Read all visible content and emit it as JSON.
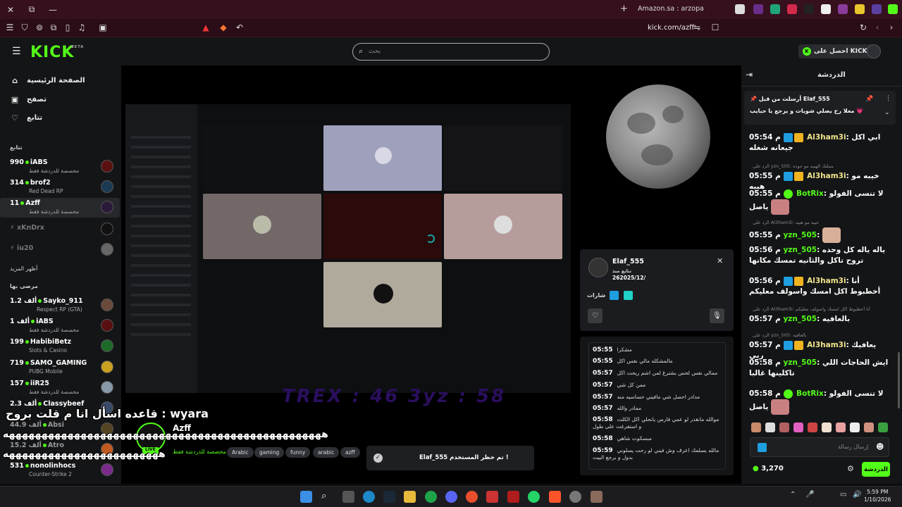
{
  "browser": {
    "tab_title": "Amazon.sa : arzopa",
    "url": "kick.com/azff"
  },
  "header": {
    "logo": "KICK",
    "logo_sup": "BETA",
    "search_placeholder": "بحث",
    "get_kicks": "احصل على KICKs",
    "kicks_badge": "K"
  },
  "sidebar": {
    "nav": [
      {
        "label": "الصفحة الرئيسية",
        "icon": "home-icon",
        "glyph": "⌂"
      },
      {
        "label": "تصفح",
        "icon": "browse-icon",
        "glyph": "▣"
      },
      {
        "label": "تتابع",
        "icon": "heart-icon",
        "glyph": "♡"
      }
    ],
    "following_title": "تتابع",
    "following": [
      {
        "count": "990",
        "name": "iABS",
        "sub": "مخصصة للدردشة فقط"
      },
      {
        "count": "314",
        "name": "brof2",
        "sub": "Red Dead RP"
      },
      {
        "count": "11",
        "name": "Azff",
        "sub": "مخصصة للدردشة فقط"
      }
    ],
    "offline": [
      "xKnDrx",
      "iu20"
    ],
    "show_more": "أظهر المزيد",
    "recommended_title": "مرصى بها",
    "recommended": [
      {
        "count": "1.2 ألف",
        "name": "Sayko_911",
        "sub": "Respect RP (GTA)"
      },
      {
        "count": "1 ألف",
        "name": "iABS",
        "sub": "مخصصة للدردشة فقط"
      },
      {
        "count": "199",
        "name": "HabibiBetz",
        "sub": "Slots & Casino"
      },
      {
        "count": "719",
        "name": "SAMO_GAMING",
        "sub": "PUBG Mobile"
      },
      {
        "count": "157",
        "name": "iiR25",
        "sub": "مخصصة للدردشة فقط"
      },
      {
        "count": "2.3 ألف",
        "name": "Classybeef",
        "sub": ""
      },
      {
        "count": "44.9 ألف",
        "name": "Absi",
        "sub": ""
      },
      {
        "count": "15.2 ألف",
        "name": "Atro",
        "sub": ""
      },
      {
        "count": "531",
        "name": "nonolinhocs",
        "sub": "Counter-Strike 2"
      }
    ]
  },
  "video": {
    "overlay_text": "TREX : 46   3yz : 58",
    "caption_top": "قاعده اسأل انا م قلت بروح : wyara",
    "caption_spam_1": "هههههههههههههههههههههههههههههههههههههههههههههههههه",
    "caption_spam_2": "ههههههههههههههههههههههههه"
  },
  "streamer": {
    "name": "Azff",
    "live": "LIVE",
    "category": "مخصصة للدردشة فقط",
    "tags": [
      "Arabic",
      "gaming",
      "funny",
      "arabic",
      "azff"
    ]
  },
  "toast": {
    "message": "Elaf_555 تم حظر المستخدم !"
  },
  "usercard": {
    "name": "Elaf_555",
    "follow_label": "تتابع منذ",
    "date": "262025/12/",
    "badges_label": "شارات"
  },
  "history": [
    {
      "time": "05:55",
      "text": "مشكرا"
    },
    {
      "time": "05:55",
      "text": "مالمشكله مالي نفس اكل"
    },
    {
      "time": "05:57",
      "text": "ممالي نفس لحس بشترغ لمن اشم ريحت اكل"
    },
    {
      "time": "05:57",
      "text": "ممن كل شي"
    },
    {
      "time": "05:57",
      "text": "مدادر احصل شي مافيني حساسيه منه"
    },
    {
      "time": "05:57",
      "text": "ممادر والله"
    },
    {
      "time": "05:58",
      "text": "موالله مانقدر لو عمي فارس يانحلي اكل الكلت و استفرغت على طول"
    },
    {
      "time": "05:58",
      "text": "مبسكوت شاهي"
    },
    {
      "time": "05:59",
      "text": "مالله يسلمك اعرف وش فيني لو رحت يسلوني بدول و برجع البيت"
    }
  ],
  "chat": {
    "title": "الدردشة",
    "pinned_from": "أرسلت من قبل Elaf_555",
    "pinned_text": "معلا رح يصلي شويات و يرجع يا حبايب 💗",
    "messages": [
      {
        "time": "05:54",
        "user": "Al3ham3i",
        "text": "ابي اكل جيعانه شغله",
        "userColor": "#f0e68c"
      },
      {
        "reply": "الرد على yzn_505: مملتك الهيبه مو جوده"
      },
      {
        "time": "05:55",
        "user": "Al3ham3i",
        "text": "خيبه مو هيبه",
        "userColor": "#f0e68c"
      },
      {
        "time": "05:55",
        "user": "BotRix",
        "text": "لا تنسى الفولو ياصل",
        "userColor": "#53fc18"
      },
      {
        "reply": "الرد على Al3ham3i: خيبه مو هيبه"
      },
      {
        "time": "05:55",
        "user": "yzn_505",
        "text": "",
        "userColor": "#53fc18"
      },
      {
        "time": "05:56",
        "user": "yzn_505",
        "text": "ياله ياله كل وحده تروح تاكل والثانيه تمسك مكانها",
        "userColor": "#53fc18"
      },
      {
        "time": "05:56",
        "user": "Al3ham3i",
        "text": "أنا أخطبوط اكل امسك واسولف معليكم",
        "userColor": "#f0e68c"
      },
      {
        "reply": "الرد على Al3ham3i: أنا أخطبوط اكل امسك واسولف معليكم"
      },
      {
        "time": "05:57",
        "user": "yzn_505",
        "text": "بالعافيه",
        "userColor": "#53fc18"
      },
      {
        "reply": "الرد على yzn_505: بالعافيه"
      },
      {
        "time": "05:57",
        "user": "Al3ham3i",
        "text": "يعافيك ربي",
        "userColor": "#f0e68c"
      },
      {
        "time": "05:58",
        "user": "yzn_505",
        "text": "ايش الحاجات اللي تاكلينها غالبا",
        "userColor": "#53fc18"
      },
      {
        "time": "05:58",
        "user": "BotRix",
        "text": "لا تنسى الفولو ياصل",
        "userColor": "#53fc18"
      }
    ],
    "input_placeholder": "إرسال رسالة",
    "points": "3,270",
    "send_label": "الدردشة"
  },
  "taskbar": {
    "time": "5:59 PM",
    "date": "1/10/2026"
  },
  "colors": {
    "accent": "#53fc18",
    "titlebar": "#36101d",
    "bg": "#0b0b0d"
  }
}
